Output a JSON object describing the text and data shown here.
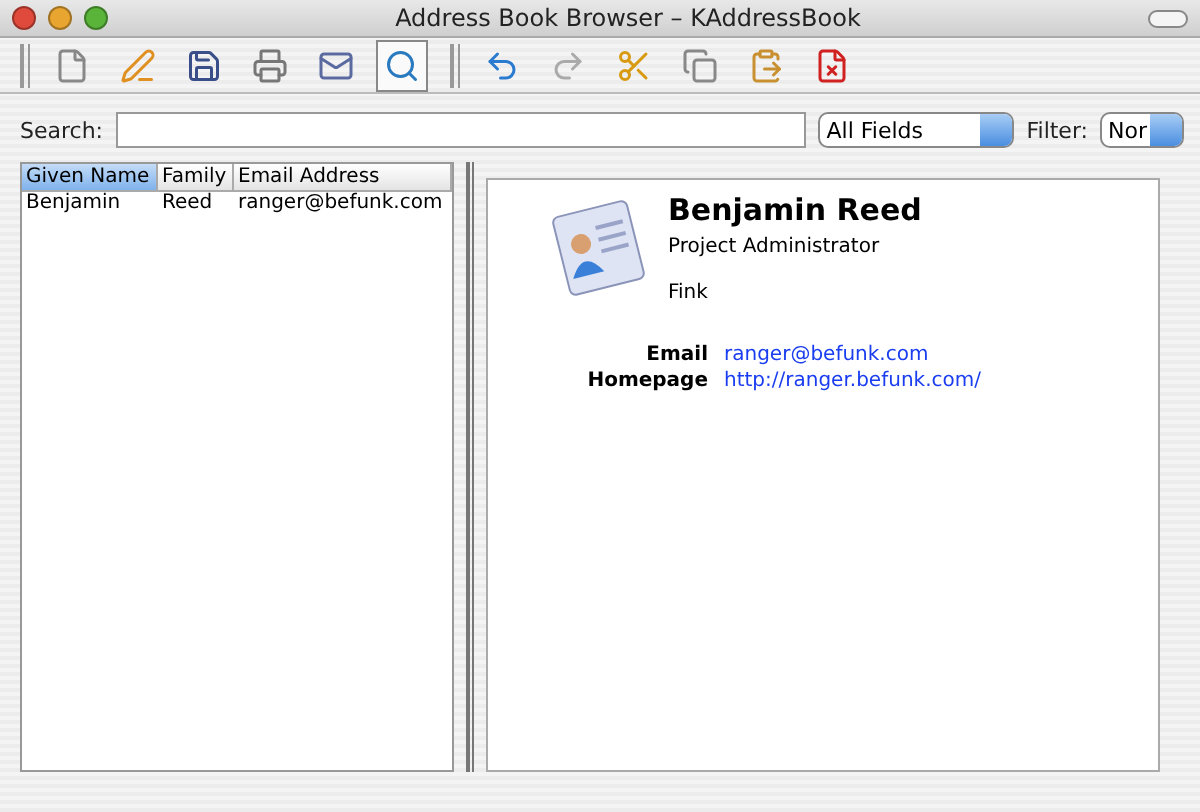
{
  "window": {
    "title": "Address Book Browser – KAddressBook"
  },
  "toolbar": [
    {
      "kind": "new",
      "selected": false,
      "disabled": false
    },
    {
      "kind": "edit",
      "selected": false,
      "disabled": false
    },
    {
      "kind": "save",
      "selected": false,
      "disabled": false
    },
    {
      "kind": "print",
      "selected": false,
      "disabled": false
    },
    {
      "kind": "mail",
      "selected": false,
      "disabled": false
    },
    {
      "kind": "search",
      "selected": true,
      "disabled": false
    },
    {
      "kind": "separator"
    },
    {
      "kind": "undo",
      "selected": false,
      "disabled": false
    },
    {
      "kind": "redo",
      "selected": false,
      "disabled": true
    },
    {
      "kind": "cut",
      "selected": false,
      "disabled": false
    },
    {
      "kind": "copy",
      "selected": false,
      "disabled": false
    },
    {
      "kind": "paste",
      "selected": false,
      "disabled": false
    },
    {
      "kind": "delete",
      "selected": false,
      "disabled": false
    }
  ],
  "search": {
    "label": "Search:",
    "field_select": "All Fields",
    "filter_label": "Filter:",
    "filter_select": "Nor"
  },
  "table": {
    "columns": [
      {
        "label": "Given Name",
        "selected": true
      },
      {
        "label": "Family",
        "selected": false
      },
      {
        "label": "Email Address",
        "selected": false
      }
    ],
    "rows": [
      [
        "Benjamin",
        "Reed",
        "ranger@befunk.com"
      ]
    ]
  },
  "contact": {
    "name": "Benjamin Reed",
    "role": "Project Administrator",
    "organization": "Fink",
    "fields": [
      {
        "label": "Email",
        "value": "ranger@befunk.com"
      },
      {
        "label": "Homepage",
        "value": "http://ranger.befunk.com/"
      }
    ]
  }
}
